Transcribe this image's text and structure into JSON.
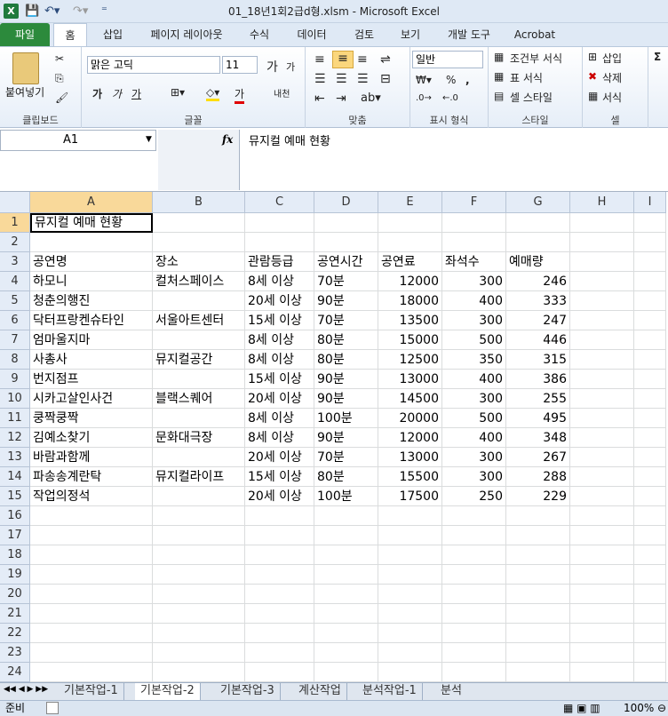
{
  "window": {
    "title": "01_18년1회2급d형.xlsm  -  Microsoft Excel"
  },
  "ribbon_tabs": [
    "파일",
    "홈",
    "삽입",
    "페이지 레이아웃",
    "수식",
    "데이터",
    "검토",
    "보기",
    "개발 도구",
    "Acrobat"
  ],
  "ribbon": {
    "clipboard": {
      "label": "클립보드",
      "paste": "붙여넣기"
    },
    "font": {
      "label": "글꼴",
      "name": "맑은 고딕",
      "size": "11",
      "grow": "가",
      "shrink": "가",
      "bold": "가",
      "italic": "가",
      "underline": "가",
      "color_letter": "가",
      "phonetic": "내천"
    },
    "alignment": {
      "label": "맞춤"
    },
    "number": {
      "label": "표시 형식",
      "format": "일반",
      "percent": "%"
    },
    "styles": {
      "label": "스타일",
      "conditional": "조건부 서식",
      "table": "표 서식",
      "cell": "셀 스타일"
    },
    "cells": {
      "label": "셀",
      "insert": "삽입",
      "delete": "삭제",
      "format": "서식"
    }
  },
  "formula_bar": {
    "name_box": "A1",
    "fx": "fx",
    "content": "뮤지컬 예매 현황"
  },
  "columns": [
    "A",
    "B",
    "C",
    "D",
    "E",
    "F",
    "G",
    "H",
    "I"
  ],
  "rows": [
    [
      "뮤지컬 예매 현황",
      "",
      "",
      "",
      "",
      "",
      ""
    ],
    [
      "",
      "",
      "",
      "",
      "",
      "",
      ""
    ],
    [
      "공연명",
      "장소",
      "관람등급",
      "공연시간",
      "공연료",
      "좌석수",
      "예매량"
    ],
    [
      "하모니",
      "컬처스페이스",
      "8세 이상",
      "70분",
      "12000",
      "300",
      "246"
    ],
    [
      "청춘의행진",
      "",
      "20세 이상",
      "90분",
      "18000",
      "400",
      "333"
    ],
    [
      "닥터프랑켄슈타인",
      "서울아트센터",
      "15세 이상",
      "70분",
      "13500",
      "300",
      "247"
    ],
    [
      "엄마울지마",
      "",
      "8세 이상",
      "80분",
      "15000",
      "500",
      "446"
    ],
    [
      "사총사",
      "뮤지컬공간",
      "8세 이상",
      "80분",
      "12500",
      "350",
      "315"
    ],
    [
      "번지점프",
      "",
      "15세 이상",
      "90분",
      "13000",
      "400",
      "386"
    ],
    [
      "시카고살인사건",
      "블랙스퀘어",
      "20세 이상",
      "90분",
      "14500",
      "300",
      "255"
    ],
    [
      "쿵짝쿵짝",
      "",
      "8세 이상",
      "100분",
      "20000",
      "500",
      "495"
    ],
    [
      "김예소찾기",
      "문화대극장",
      "8세 이상",
      "90분",
      "12000",
      "400",
      "348"
    ],
    [
      "바람과함께",
      "",
      "20세 이상",
      "70분",
      "13000",
      "300",
      "267"
    ],
    [
      "파송송계란탁",
      "뮤지컬라이프",
      "15세 이상",
      "80분",
      "15500",
      "300",
      "288"
    ],
    [
      "작업의정석",
      "",
      "20세 이상",
      "100분",
      "17500",
      "250",
      "229"
    ],
    [
      "",
      "",
      "",
      "",
      "",
      "",
      ""
    ],
    [
      "",
      "",
      "",
      "",
      "",
      "",
      ""
    ],
    [
      "",
      "",
      "",
      "",
      "",
      "",
      ""
    ],
    [
      "",
      "",
      "",
      "",
      "",
      "",
      ""
    ],
    [
      "",
      "",
      "",
      "",
      "",
      "",
      ""
    ],
    [
      "",
      "",
      "",
      "",
      "",
      "",
      ""
    ],
    [
      "",
      "",
      "",
      "",
      "",
      "",
      ""
    ],
    [
      "",
      "",
      "",
      "",
      "",
      "",
      ""
    ],
    [
      "",
      "",
      "",
      "",
      "",
      "",
      ""
    ]
  ],
  "row_numbers": [
    "1",
    "2",
    "3",
    "4",
    "5",
    "6",
    "7",
    "8",
    "9",
    "10",
    "11",
    "12",
    "13",
    "14",
    "15",
    "16",
    "17",
    "18",
    "19",
    "20",
    "21",
    "22",
    "23",
    "24"
  ],
  "sheet_tabs": [
    "기본작업-1",
    "기본작업-2",
    "기본작업-3",
    "계산작업",
    "분석작업-1",
    "분석"
  ],
  "status": {
    "mode": "준비",
    "zoom": "100%"
  }
}
